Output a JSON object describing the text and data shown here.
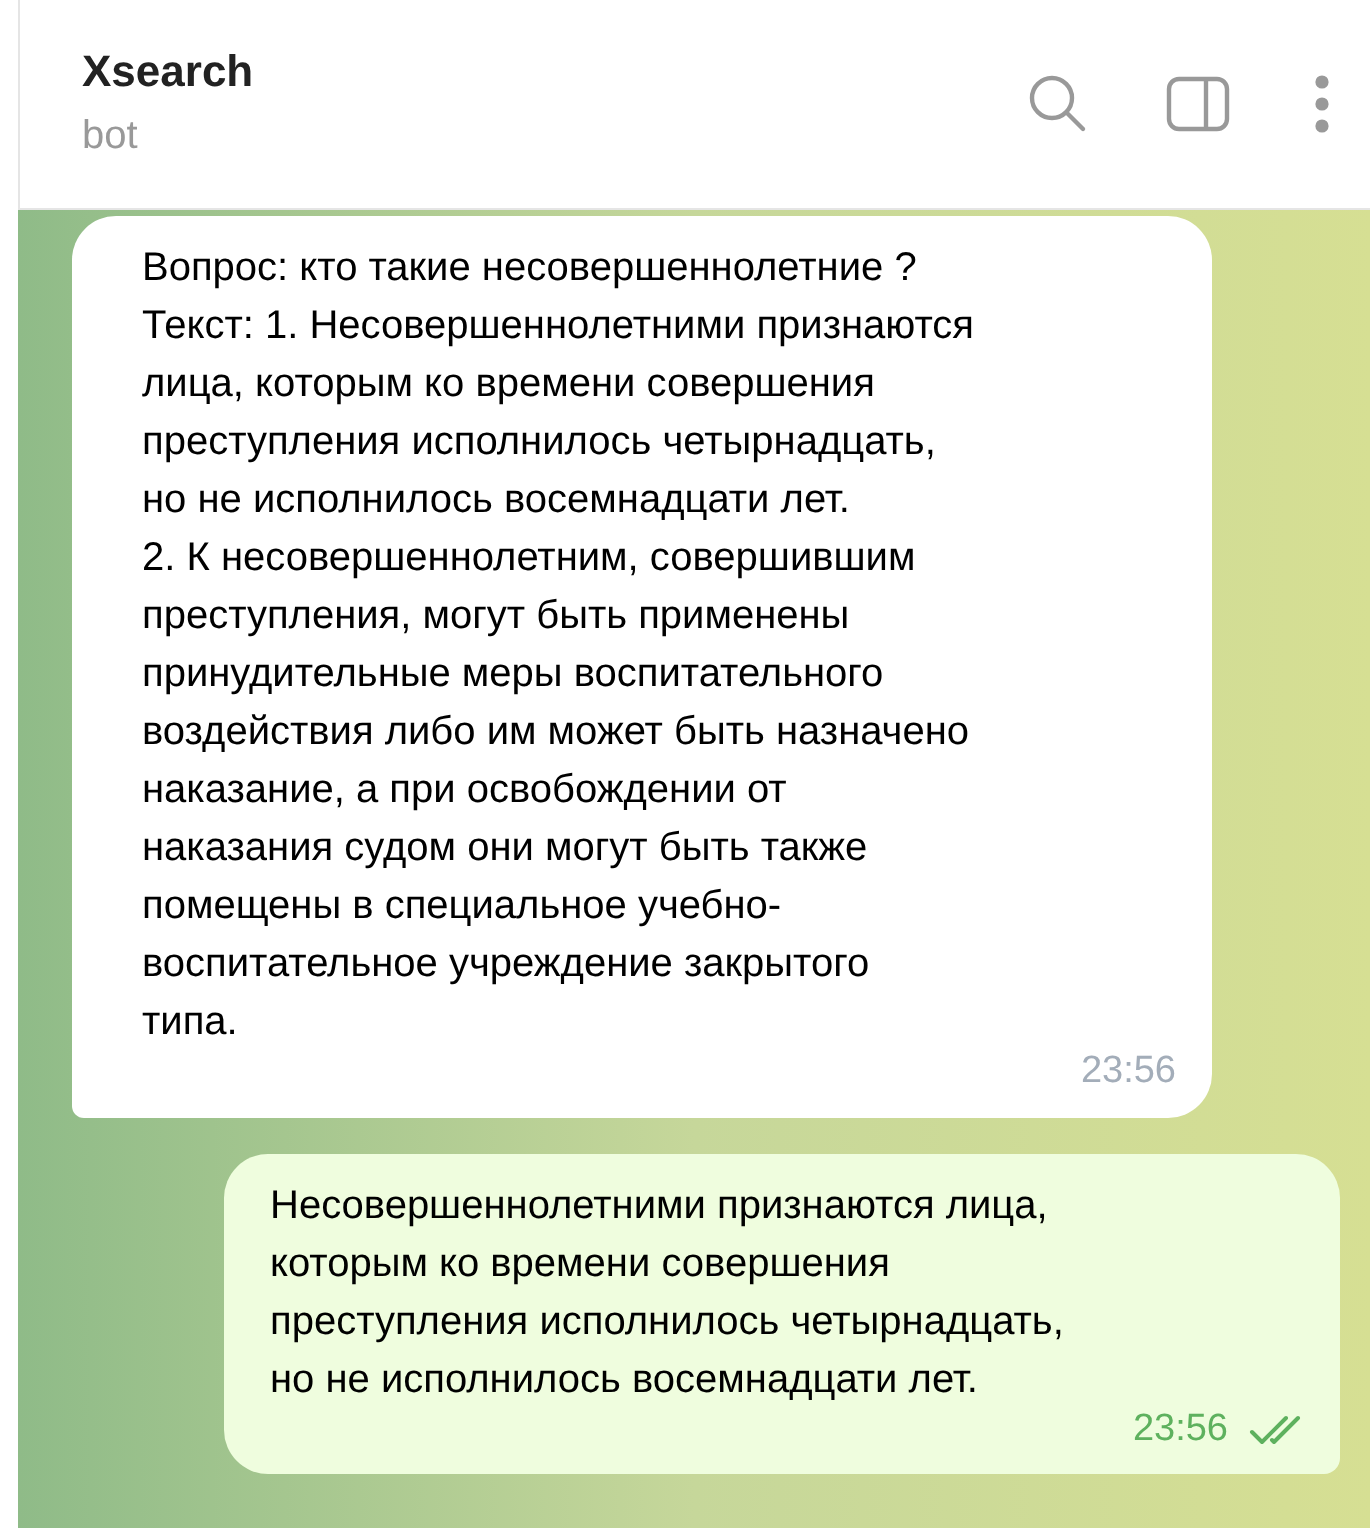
{
  "header": {
    "title": "Xsearch",
    "subtitle": "bot"
  },
  "messages": [
    {
      "kind": "incoming",
      "lines": [
        "Вопрос: кто такие несовершеннолетние ?",
        "Текст: 1. Несовершеннолетними признаются",
        "лица, которым ко времени совершения",
        "преступления исполнилось четырнадцать,",
        "но не исполнилось восемнадцати лет.",
        "2. К несовершеннолетним, совершившим",
        "преступления, могут быть применены",
        "принудительные меры воспитательного",
        "воздействия либо им может быть назначено",
        "наказание, а при освобождении от",
        "наказания судом они могут быть также",
        "помещены в специальное учебно-",
        "воспитательное учреждение закрытого",
        "типа."
      ],
      "time": "23:56"
    },
    {
      "kind": "outgoing",
      "lines": [
        "Несовершеннолетними признаются лица,",
        "которым ко времени совершения",
        "преступления исполнилось четырнадцать,",
        "но не исполнилось восемнадцати лет."
      ],
      "time": "23:56",
      "read": true
    }
  ]
}
